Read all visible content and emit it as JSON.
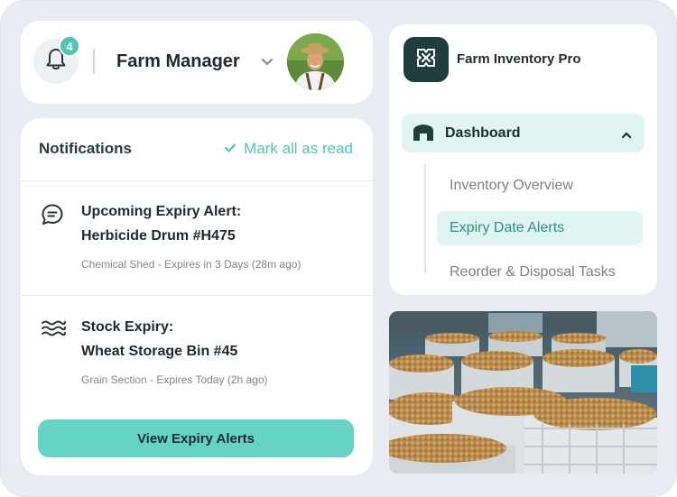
{
  "header": {
    "notification_count": "4",
    "user_name": "Farm Manager"
  },
  "notifications": {
    "title": "Notifications",
    "mark_all_label": "Mark all as read",
    "items": [
      {
        "icon": "chat-bubble-icon",
        "title_line1": "Upcoming Expiry Alert:",
        "title_line2": "Herbicide Drum #H475",
        "meta": "Chemical Shed - Expires in 3 Days (28m ago)"
      },
      {
        "icon": "waves-icon",
        "title_line1": "Stock Expiry:",
        "title_line2": "Wheat Storage Bin #45",
        "meta": "Grain Section - Expires Today (2h ago)"
      }
    ],
    "button_label": "View Expiry Alerts"
  },
  "sidebar": {
    "app_name": "Farm Inventory Pro",
    "active_section": "Dashboard",
    "sub_items": [
      {
        "label": "Inventory Overview",
        "active": false
      },
      {
        "label": "Expiry Date Alerts",
        "active": true
      },
      {
        "label": "Reorder & Disposal Tasks",
        "active": false
      }
    ]
  },
  "colors": {
    "accent": "#4fc7b6",
    "button": "#66d4c5",
    "active_bg": "#e0f5f2",
    "logo_bg": "#1f3d3a",
    "frame_bg": "#e9ecf2"
  }
}
